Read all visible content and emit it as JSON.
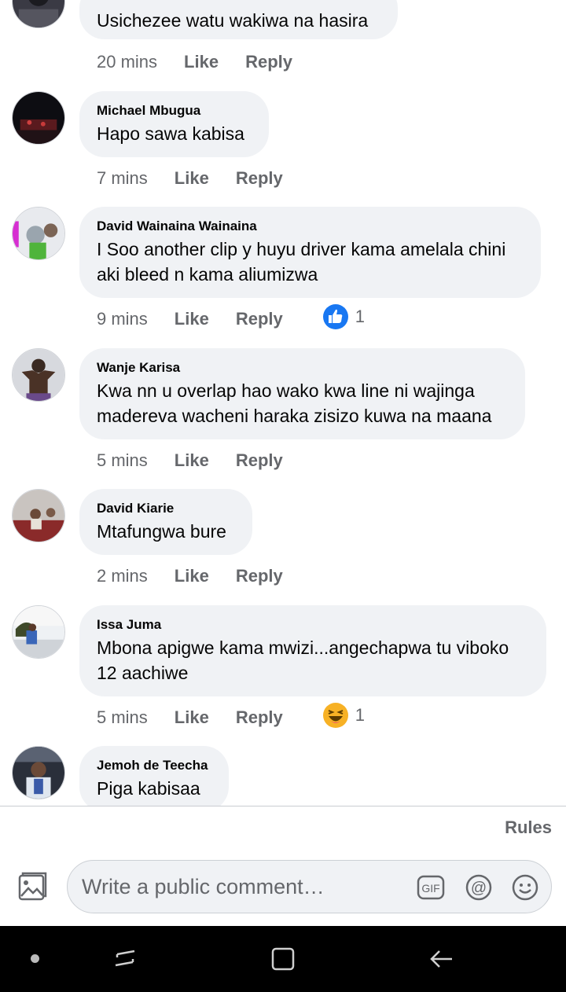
{
  "comments": [
    {
      "author": "",
      "text": "Usichezee watu wakiwa na hasira",
      "time": "20 mins",
      "like": "Like",
      "reply": "Reply"
    },
    {
      "author": "Michael Mbugua",
      "text": "Hapo sawa kabisa",
      "time": "7 mins",
      "like": "Like",
      "reply": "Reply"
    },
    {
      "author": "David Wainaina Wainaina",
      "text_lines": [
        "I Soo another clip y huyu driver kama amelala chini",
        "aki bleed n kama aliumizwa"
      ],
      "time": "9 mins",
      "like": "Like",
      "reply": "Reply",
      "reaction": {
        "icon": "like-reaction-icon",
        "count": "1",
        "color": "#1877f2"
      }
    },
    {
      "author": "Wanje Karisa",
      "text_lines": [
        "Kwa nn u overlap hao wako kwa line ni wajinga",
        "madereva wacheni haraka zisizo kuwa na maana"
      ],
      "time": "5 mins",
      "like": "Like",
      "reply": "Reply"
    },
    {
      "author": "David Kiarie",
      "text": "Mtafungwa bure",
      "time": "2 mins",
      "like": "Like",
      "reply": "Reply"
    },
    {
      "author": "Issa Juma",
      "text_lines": [
        "Mbona apigwe kama mwizi...angechapwa tu viboko",
        "12 aachiwe"
      ],
      "time": "5 mins",
      "like": "Like",
      "reply": "Reply",
      "reaction": {
        "icon": "haha-reaction-icon",
        "count": "1",
        "color": "#f7b125"
      }
    },
    {
      "author": "Jemoh de Teecha",
      "text": "Piga kabisaa"
    }
  ],
  "footer": {
    "rules_label": "Rules",
    "compose_placeholder": "Write a public comment…",
    "gif_label": "GIF"
  },
  "nav": {
    "icons": [
      "nav-dot-icon",
      "recent-apps-icon",
      "home-icon",
      "back-icon"
    ]
  },
  "colors": {
    "bubble": "#f0f2f5",
    "secondary_text": "#65676b",
    "like_blue": "#1877f2"
  }
}
